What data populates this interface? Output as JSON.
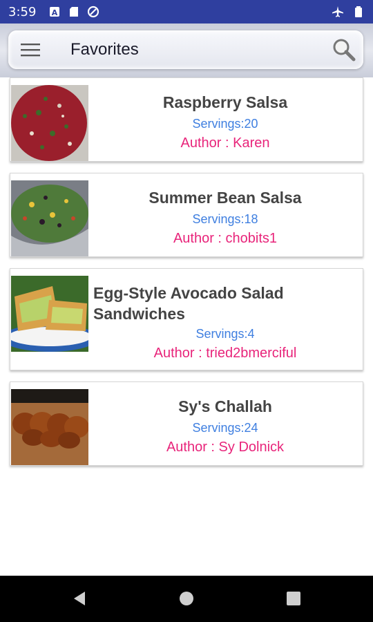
{
  "status_bar": {
    "time": "3:59",
    "icons": [
      "text-a-icon",
      "sd-card-icon",
      "sync-icon",
      "airplane-mode-icon",
      "battery-icon"
    ]
  },
  "app_bar": {
    "title": "Favorites",
    "menu_icon": "hamburger-menu-icon",
    "search_icon": "search-icon"
  },
  "recipes": [
    {
      "title": "Raspberry Salsa",
      "servings": "Servings:20",
      "author": "Author : Karen",
      "image": "raspberry-salsa-photo"
    },
    {
      "title": "Summer Bean Salsa",
      "servings": "Servings:18",
      "author": "Author : chobits1",
      "image": "bean-salsa-photo"
    },
    {
      "title": "Egg-Style Avocado Salad Sandwiches",
      "title_line1": "Egg-Style Avocado Salad",
      "title_line2": "Sandwiches",
      "servings": "Servings:4",
      "author": "Author : tried2bmerciful",
      "image": "avocado-sandwich-photo"
    },
    {
      "title": "Sy's Challah",
      "servings": "Servings:24",
      "author": "Author : Sy Dolnick",
      "image": "challah-bread-photo"
    }
  ],
  "colors": {
    "status_bar": "#2f3f9f",
    "servings_text": "#3f7fe0",
    "author_text": "#e8247a",
    "title_text": "#444444"
  },
  "nav_bar": {
    "buttons": [
      "back-icon",
      "home-icon",
      "recents-icon"
    ]
  }
}
